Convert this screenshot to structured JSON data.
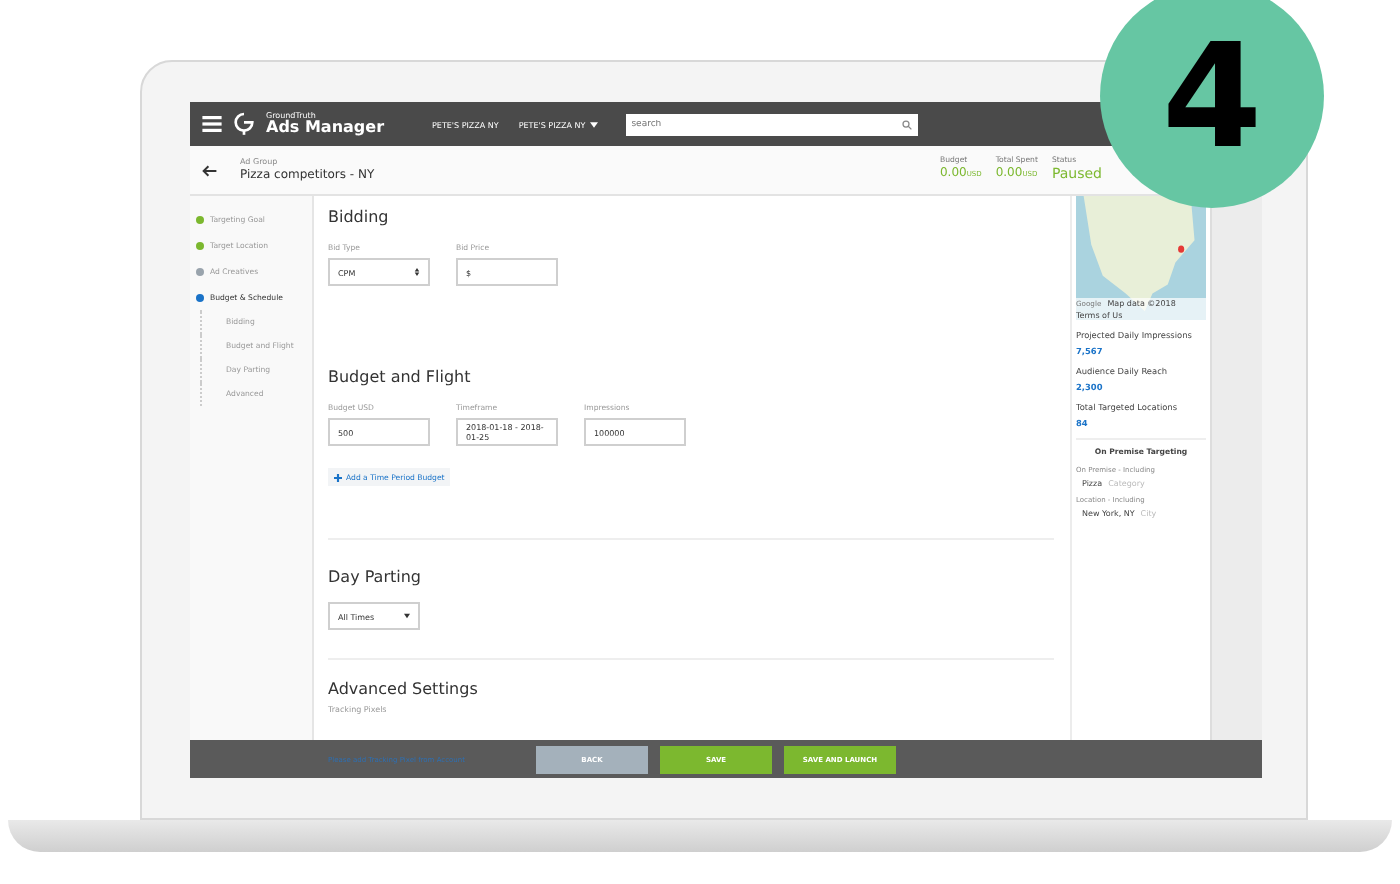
{
  "badge": {
    "label": "4"
  },
  "app_bar": {
    "brand_small": "GroundTruth",
    "brand": "Ads Manager",
    "account_menus": [
      {
        "label": "PETE'S PIZZA NY",
        "dropdown": false
      },
      {
        "label": "PETE'S PIZZA NY",
        "dropdown": true
      }
    ],
    "search": {
      "placeholder": "search"
    }
  },
  "header": {
    "label": "Ad Group",
    "title": "Pizza competitors - NY",
    "stats": [
      {
        "label": "Budget",
        "value": "0.00",
        "unit": "USD"
      },
      {
        "label": "Total Spent",
        "value": "0.00",
        "unit": "USD"
      },
      {
        "label": "Status",
        "value": "Paused"
      }
    ]
  },
  "steps": [
    {
      "label": "Targeting Goal",
      "color": "#7cb82f",
      "selected": false
    },
    {
      "label": "Target Location",
      "color": "#7cb82f",
      "selected": false
    },
    {
      "label": "Ad Creatives",
      "color": "#9aa4ad",
      "selected": false
    },
    {
      "label": "Budget & Schedule",
      "color": "#1a73c8",
      "selected": true,
      "children": [
        {
          "label": "Bidding"
        },
        {
          "label": "Budget and Flight"
        },
        {
          "label": "Day Parting"
        },
        {
          "label": "Advanced"
        }
      ]
    }
  ],
  "sections": [
    {
      "title": "Bidding",
      "fields": [
        {
          "label": "Bid Type",
          "kind": "select",
          "value": "CPM"
        },
        {
          "label": "Bid Price",
          "kind": "input",
          "value": "$"
        }
      ]
    },
    {
      "title": "Budget and Flight",
      "fields": [
        {
          "label": "Budget USD",
          "kind": "input",
          "value": "500"
        },
        {
          "label": "Timeframe",
          "kind": "input",
          "value": "2018-01-18 - 2018-01-25"
        },
        {
          "label": "Impressions",
          "kind": "input",
          "value": "100000"
        }
      ],
      "action": "Add a Time Period Budget"
    },
    {
      "title": "Day Parting",
      "fields": [
        {
          "kind": "dropdown",
          "value": "All Times"
        }
      ]
    },
    {
      "title": "Advanced Settings",
      "note": "Tracking Pixels"
    }
  ],
  "footer": {
    "message": "Please add Tracking Pixel from Account",
    "buttons": [
      {
        "label": "BACK",
        "kind": "secondary"
      },
      {
        "label": "SAVE",
        "kind": "primary"
      },
      {
        "label": "SAVE AND LAUNCH",
        "kind": "primary"
      }
    ]
  },
  "side_panel": {
    "map": {
      "brand": "Google",
      "attribution": "Map data ©2018",
      "terms": "Terms of Us"
    },
    "metrics": [
      {
        "label": "Projected Daily Impressions",
        "value": "7,567"
      },
      {
        "label": "Audience Daily Reach",
        "value": "2,300"
      },
      {
        "label": "Total Targeted Locations",
        "value": "84"
      }
    ],
    "targeting_title": "On Premise Targeting",
    "groups": [
      {
        "label": "On Premise - Including",
        "value": "Pizza",
        "type": "Category"
      },
      {
        "label": "Location - Including",
        "value": "New York, NY",
        "type": "City"
      }
    ]
  }
}
